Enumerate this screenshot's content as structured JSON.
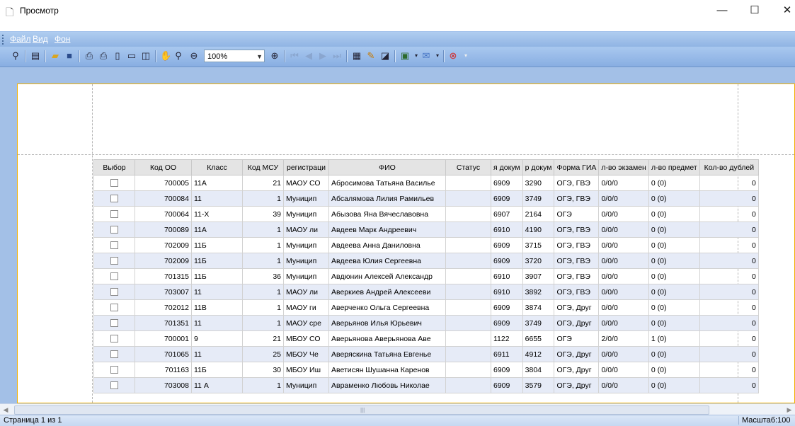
{
  "window": {
    "title": "Просмотр",
    "minimize": "—",
    "maximize": "☐",
    "close": "✕"
  },
  "menu": {
    "items": [
      "Файл",
      "Вид",
      "Фон"
    ]
  },
  "toolbar": {
    "zoom": "100%"
  },
  "table": {
    "headers": [
      "Выбор",
      "Код ОО",
      "Класс",
      "Код МСУ",
      "регистраци",
      "ФИО",
      "Статус",
      "я докум",
      "р докум",
      "Форма ГИА",
      "л-во экзамен",
      "л-во предмет",
      "Кол-во дублей"
    ],
    "rows": [
      [
        "",
        "700005",
        "11А",
        "21",
        "МАОУ СО",
        "Абросимова Татьяна Василье",
        "",
        "6909",
        "3290",
        "ОГЭ, ГВЭ",
        "0/0/0",
        "0 (0)",
        "0"
      ],
      [
        "",
        "700084",
        "11",
        "1",
        "Муницип",
        "Абсалямова Лилия Рамильев",
        "",
        "6909",
        "3749",
        "ОГЭ, ГВЭ",
        "0/0/0",
        "0 (0)",
        "0"
      ],
      [
        "",
        "700064",
        "11-Х",
        "39",
        "Муницип",
        "Абызова Яна Вячеславовна",
        "",
        "6907",
        "2164",
        "ОГЭ",
        "0/0/0",
        "0 (0)",
        "0"
      ],
      [
        "",
        "700089",
        "11А",
        "1",
        "МАОУ ли",
        "Авдеев Марк Андреевич",
        "",
        "6910",
        "4190",
        "ОГЭ, ГВЭ",
        "0/0/0",
        "0 (0)",
        "0"
      ],
      [
        "",
        "702009",
        "11Б",
        "1",
        "Муницип",
        "Авдеева Анна Даниловна",
        "",
        "6909",
        "3715",
        "ОГЭ, ГВЭ",
        "0/0/0",
        "0 (0)",
        "0"
      ],
      [
        "",
        "702009",
        "11Б",
        "1",
        "Муницип",
        "Авдеева Юлия Сергеевна",
        "",
        "6909",
        "3720",
        "ОГЭ, ГВЭ",
        "0/0/0",
        "0 (0)",
        "0"
      ],
      [
        "",
        "701315",
        "11Б",
        "36",
        "Муницип",
        "Авдюнин Алексей Александр",
        "",
        "6910",
        "3907",
        "ОГЭ, ГВЭ",
        "0/0/0",
        "0 (0)",
        "0"
      ],
      [
        "",
        "703007",
        "11",
        "1",
        "МАОУ ли",
        "Аверкиев Андрей Алексееви",
        "",
        "6910",
        "3892",
        "ОГЭ, ГВЭ",
        "0/0/0",
        "0 (0)",
        "0"
      ],
      [
        "",
        "702012",
        "11В",
        "1",
        "МАОУ ги",
        "Аверченко Ольга Сергеевна",
        "",
        "6909",
        "3874",
        "ОГЭ, Друг",
        "0/0/0",
        "0 (0)",
        "0"
      ],
      [
        "",
        "701351",
        "11",
        "1",
        "МАОУ сре",
        "Аверьянов Илья Юрьевич",
        "",
        "6909",
        "3749",
        "ОГЭ, Друг",
        "0/0/0",
        "0 (0)",
        "0"
      ],
      [
        "",
        "700001",
        "9",
        "21",
        "МБОУ СО",
        "Аверьянова Аверьянова Аве",
        "",
        "1122",
        "6655",
        "ОГЭ",
        "2/0/0",
        "1 (0)",
        "0"
      ],
      [
        "",
        "701065",
        "11",
        "25",
        "МБОУ Че",
        "Аверяскина Татьяна Евгенье",
        "",
        "6911",
        "4912",
        "ОГЭ, Друг",
        "0/0/0",
        "0 (0)",
        "0"
      ],
      [
        "",
        "701163",
        "11Б",
        "30",
        "МБОУ Иш",
        "Аветисян Шушанна Каренов",
        "",
        "6909",
        "3804",
        "ОГЭ, Друг",
        "0/0/0",
        "0 (0)",
        "0"
      ],
      [
        "",
        "703008",
        "11 А",
        "1",
        "Муницип",
        "Авраменко Любовь Николае",
        "",
        "6909",
        "3579",
        "ОГЭ, Друг",
        "0/0/0",
        "0 (0)",
        "0"
      ]
    ]
  },
  "status": {
    "page": "Страница 1 из 1",
    "scale": "Масштаб:100"
  },
  "colors": {
    "toolbar": "#9bbde9",
    "workspace": "#a3c0e7",
    "paper_border": "#f0b000",
    "row_alt": "#e6ebf7"
  }
}
